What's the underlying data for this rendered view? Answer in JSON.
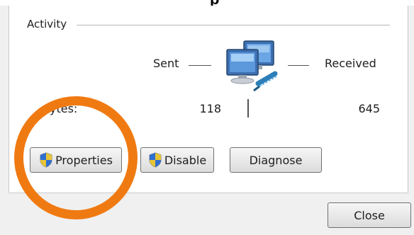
{
  "dialog": {
    "heading_fragment": "p"
  },
  "activity": {
    "group_title": "Activity",
    "sent_label": "Sent",
    "received_label": "Received",
    "bytes_label": "ytes:",
    "bytes_sent": "118",
    "bytes_received": "645",
    "network_icon": "network-computers-icon"
  },
  "buttons": {
    "properties_label": "Properties",
    "disable_label": "Disable",
    "diagnose_label": "Diagnose",
    "close_label": "Close",
    "shield_icon": "uac-shield-icon"
  },
  "annotation": {
    "ring_color": "#f07a12"
  },
  "colors": {
    "panel_bg": "#ffffff",
    "window_bg": "#f0f0f0",
    "text": "#1e1e1e"
  }
}
